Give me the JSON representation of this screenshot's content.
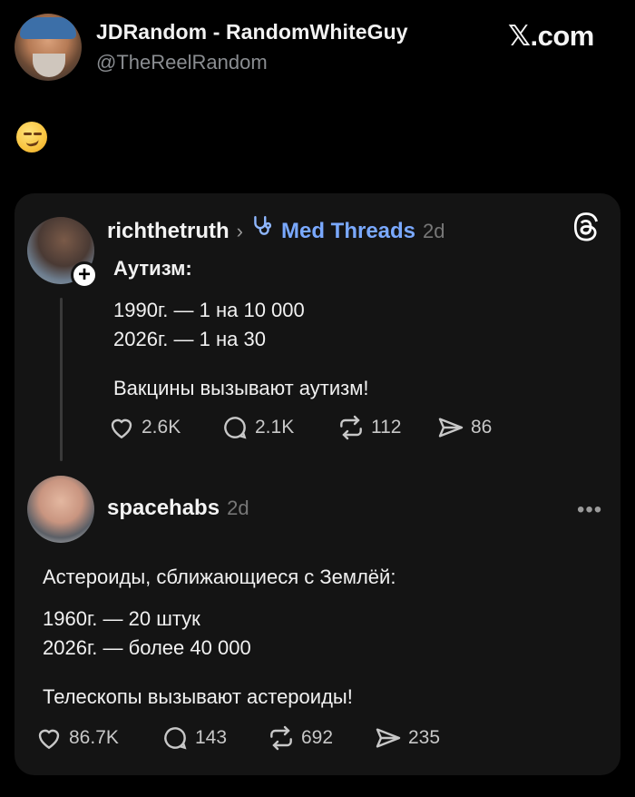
{
  "header": {
    "display_name": "JDRandom - RandomWhiteGuy",
    "handle": "@TheReelRandom",
    "brand": "𝕏.com"
  },
  "tweet": {
    "emoji": "smirking-face-emoji"
  },
  "threads_card": {
    "post1": {
      "username": "richthetruth",
      "community": "Med Threads",
      "time_ago": "2d",
      "lines": [
        "Аутизм:",
        "1990г. — 1 на 10 000",
        "2026г. — 1 на 30",
        "Вакцины вызывают аутизм!"
      ],
      "likes": "2.6K",
      "replies": "2.1K",
      "reposts": "112",
      "shares": "86"
    },
    "post2": {
      "username": "spacehabs",
      "time_ago": "2d",
      "lines": [
        "Астероиды, сближающиеся с Землёй:",
        "1960г. — 20 штук",
        "2026г. — более 40 000",
        "Телескопы вызывают астероиды!"
      ],
      "likes": "86.7K",
      "replies": "143",
      "reposts": "692",
      "shares": "235"
    }
  },
  "icons": [
    "heart-icon",
    "comment-icon",
    "repost-icon",
    "share-icon",
    "threads-logo-icon",
    "stethoscope-icon",
    "more-options-icon"
  ],
  "colors": {
    "background": "#000000",
    "card": "#141414",
    "community": "#7aa9ff"
  }
}
